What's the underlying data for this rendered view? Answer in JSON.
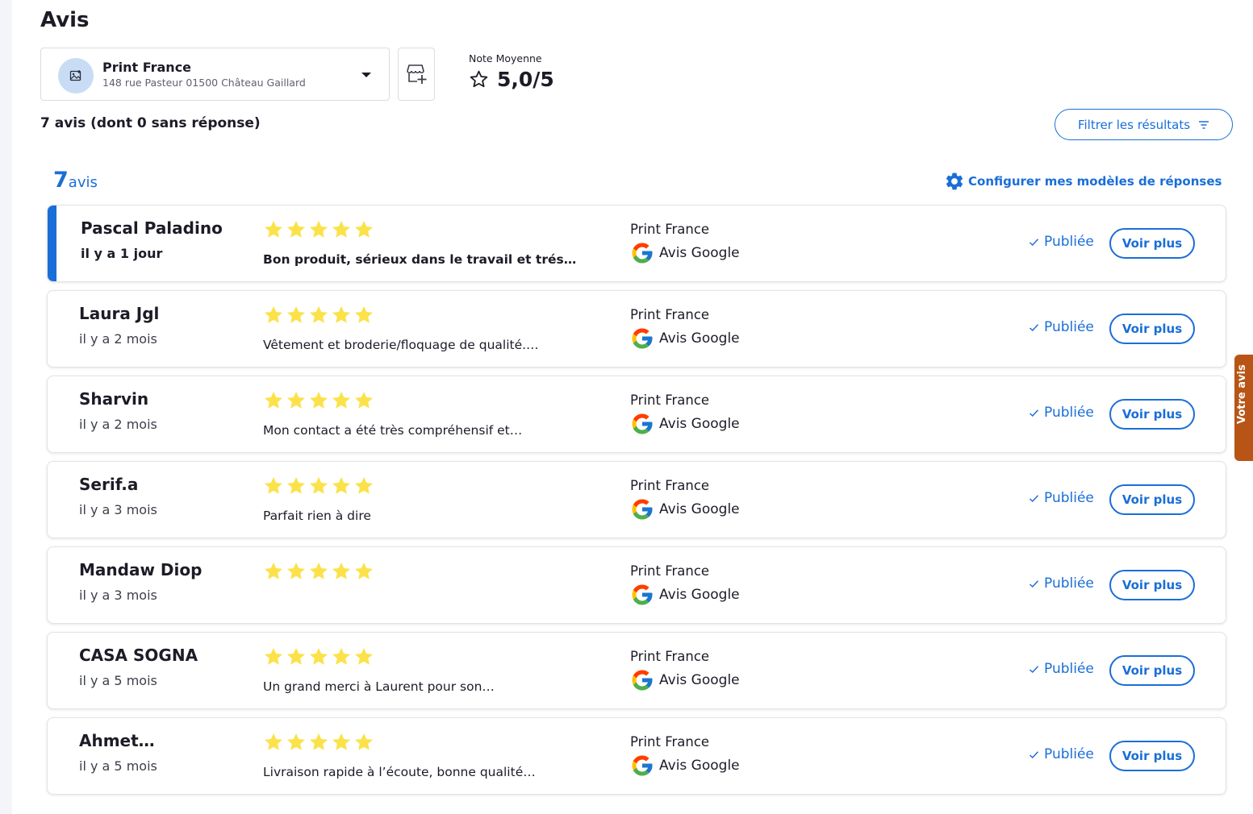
{
  "page": {
    "title": "Avis"
  },
  "store_selector": {
    "name": "Print France",
    "address": "148 rue Pasteur 01500 Château Gaillard"
  },
  "average": {
    "label": "Note Moyenne",
    "value": "5,0/5"
  },
  "summary": "7 avis (dont 0 sans réponse)",
  "filter_label": "Filtrer les résultats",
  "total": {
    "count": "7",
    "word": "avis"
  },
  "config_label": "Configurer mes modèles de réponses",
  "feedback_tab": "Votre avis",
  "colors": {
    "accent": "#1a6ed8",
    "star": "#fbe24a",
    "feedback": "#b85516"
  },
  "reviews": [
    {
      "author": "Pascal Paladino",
      "date": "il y a 1 jour",
      "rating": 5,
      "excerpt": "Bon produit, sérieux dans le travail et trés…",
      "store": "Print France",
      "source": "Avis Google",
      "status": "Publiée",
      "action": "Voir plus"
    },
    {
      "author": "Laura Jgl",
      "date": "il y a 2 mois",
      "rating": 5,
      "excerpt": "Vêtement et broderie/floquage de qualité.…",
      "store": "Print France",
      "source": "Avis Google",
      "status": "Publiée",
      "action": "Voir plus"
    },
    {
      "author": "Sharvin",
      "date": "il y a 2 mois",
      "rating": 5,
      "excerpt": "Mon contact a été très compréhensif et…",
      "store": "Print France",
      "source": "Avis Google",
      "status": "Publiée",
      "action": "Voir plus"
    },
    {
      "author": "Serif.a",
      "date": "il y a 3 mois",
      "rating": 5,
      "excerpt": "Parfait rien à dire",
      "store": "Print France",
      "source": "Avis Google",
      "status": "Publiée",
      "action": "Voir plus"
    },
    {
      "author": "Mandaw Diop",
      "date": "il y a 3 mois",
      "rating": 5,
      "excerpt": "",
      "store": "Print France",
      "source": "Avis Google",
      "status": "Publiée",
      "action": "Voir plus"
    },
    {
      "author": "CASA SOGNA",
      "date": "il y a 5 mois",
      "rating": 5,
      "excerpt": "Un grand merci à Laurent pour son…",
      "store": "Print France",
      "source": "Avis Google",
      "status": "Publiée",
      "action": "Voir plus"
    },
    {
      "author": "Ahmet…",
      "date": "il y a 5 mois",
      "rating": 5,
      "excerpt": "Livraison rapide à l’écoute, bonne qualité…",
      "store": "Print France",
      "source": "Avis Google",
      "status": "Publiée",
      "action": "Voir plus"
    }
  ]
}
